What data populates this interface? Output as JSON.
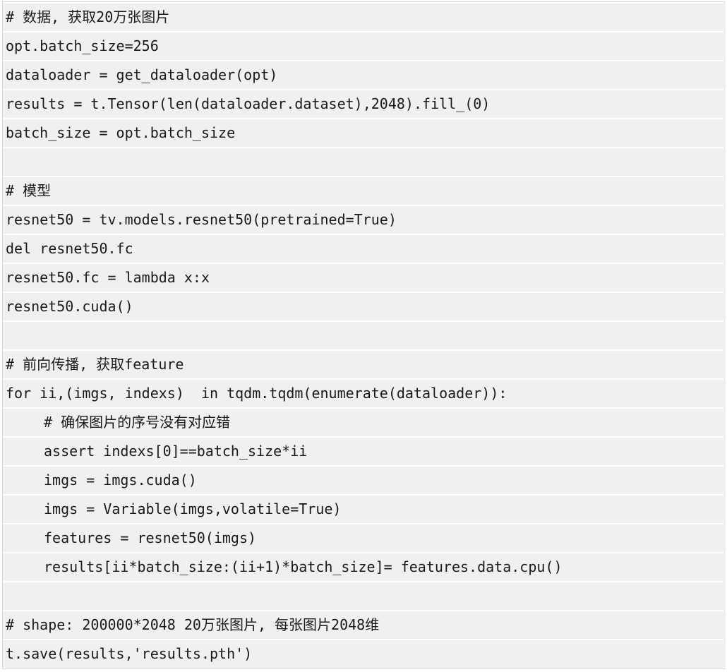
{
  "code": {
    "lines": [
      {
        "text": "# 数据, 获取20万张图片",
        "indent": 0
      },
      {
        "text": "opt.batch_size=256",
        "indent": 0
      },
      {
        "text": "dataloader = get_dataloader(opt)",
        "indent": 0
      },
      {
        "text": "results = t.Tensor(len(dataloader.dataset),2048).fill_(0)",
        "indent": 0
      },
      {
        "text": "batch_size = opt.batch_size",
        "indent": 0
      },
      {
        "text": "",
        "indent": 0
      },
      {
        "text": "# 模型",
        "indent": 0
      },
      {
        "text": "resnet50 = tv.models.resnet50(pretrained=True)",
        "indent": 0
      },
      {
        "text": "del resnet50.fc",
        "indent": 0
      },
      {
        "text": "resnet50.fc = lambda x:x",
        "indent": 0
      },
      {
        "text": "resnet50.cuda()",
        "indent": 0
      },
      {
        "text": "",
        "indent": 0
      },
      {
        "text": "# 前向传播, 获取feature",
        "indent": 0
      },
      {
        "text": "for ii,(imgs, indexs)  in tqdm.tqdm(enumerate(dataloader)):",
        "indent": 0
      },
      {
        "text": "# 确保图片的序号没有对应错",
        "indent": 1
      },
      {
        "text": "assert indexs[0]==batch_size*ii",
        "indent": 1
      },
      {
        "text": "imgs = imgs.cuda()",
        "indent": 1
      },
      {
        "text": "imgs = Variable(imgs,volatile=True)",
        "indent": 1
      },
      {
        "text": "features = resnet50(imgs)",
        "indent": 1
      },
      {
        "text": "results[ii*batch_size:(ii+1)*batch_size]= features.data.cpu()",
        "indent": 1
      },
      {
        "text": "",
        "indent": 0
      },
      {
        "text": "# shape: 200000*2048 20万张图片, 每张图片2048维",
        "indent": 0
      },
      {
        "text": "t.save(results,'results.pth')",
        "indent": 0
      }
    ]
  }
}
